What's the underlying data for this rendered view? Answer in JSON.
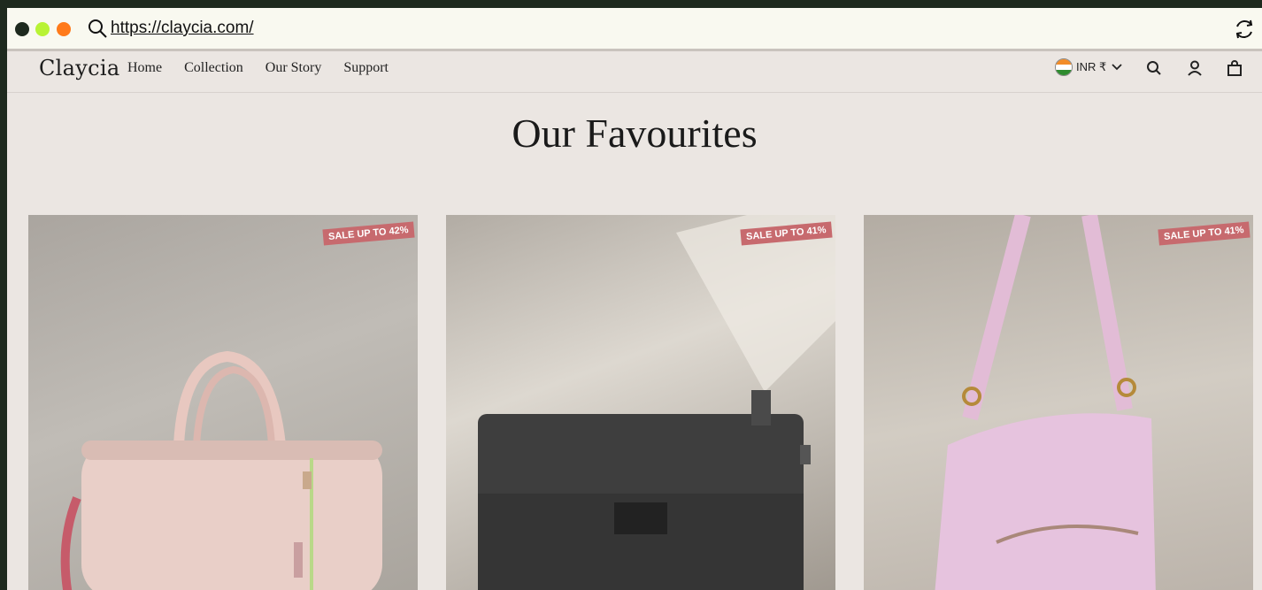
{
  "browser": {
    "url": "https://claycia.com/"
  },
  "nav": {
    "logo": "Claycia",
    "menu": [
      "Home",
      "Collection",
      "Our Story",
      "Support"
    ],
    "currency": "INR ₹"
  },
  "section": {
    "title": "Our Favourites"
  },
  "products": [
    {
      "badge": "SALE UP TO 42%"
    },
    {
      "badge": "SALE UP TO 41%"
    },
    {
      "badge": "SALE UP TO 41%"
    }
  ],
  "colors": {
    "page_bg": "#ebe6e2",
    "badge_bg": "#c76a6e",
    "chrome_bg": "#f9f9f0"
  }
}
